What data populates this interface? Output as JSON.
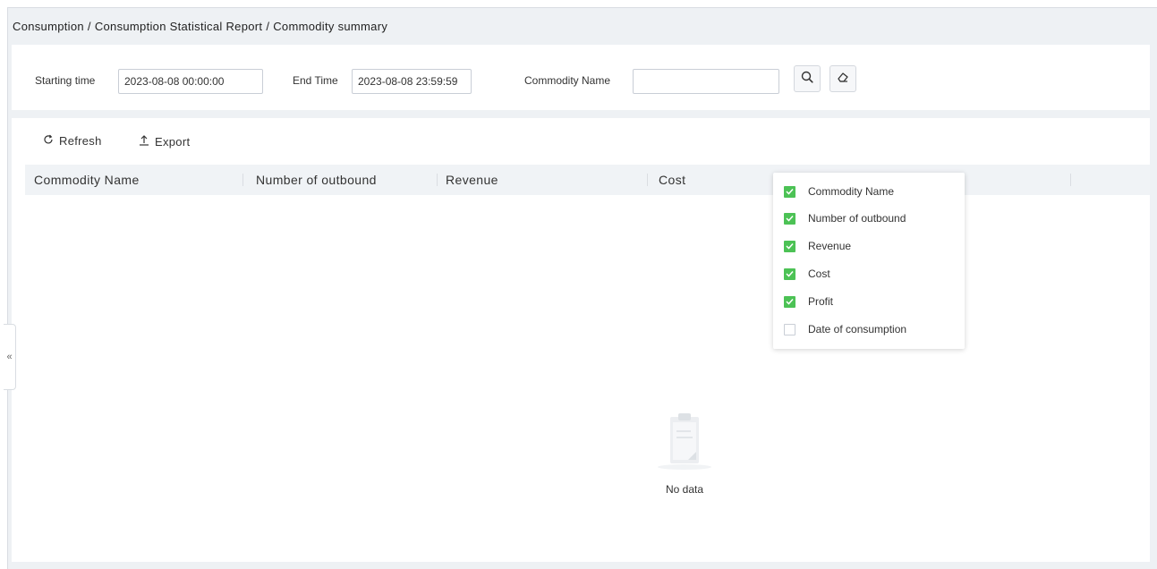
{
  "breadcrumb": [
    "Consumption",
    "Consumption Statistical Report",
    "Commodity summary"
  ],
  "breadcrumb_separator": "/",
  "search": {
    "start_label": "Starting time",
    "start_value": "2023-08-08 00:00:00",
    "end_label": "End Time",
    "end_value": "2023-08-08 23:59:59",
    "commodity_label": "Commodity Name",
    "commodity_value": "",
    "search_icon": "search-icon",
    "clear_icon": "eraser-icon"
  },
  "toolbar": {
    "refresh_label": "Refresh",
    "export_label": "Export"
  },
  "table": {
    "columns": [
      "Commodity Name",
      "Number of outbound",
      "Revenue",
      "Cost"
    ],
    "empty_text": "No data"
  },
  "column_picker": {
    "items": [
      {
        "label": "Commodity Name",
        "checked": true
      },
      {
        "label": "Number of outbound",
        "checked": true
      },
      {
        "label": "Revenue",
        "checked": true
      },
      {
        "label": "Cost",
        "checked": true
      },
      {
        "label": "Profit",
        "checked": true
      },
      {
        "label": "Date of consumption",
        "checked": false
      }
    ]
  },
  "collapse_glyph": "«",
  "colors": {
    "checkbox_checked": "#4cc255",
    "header_bg": "#f0f3f6",
    "page_bg": "#eef1f4"
  }
}
